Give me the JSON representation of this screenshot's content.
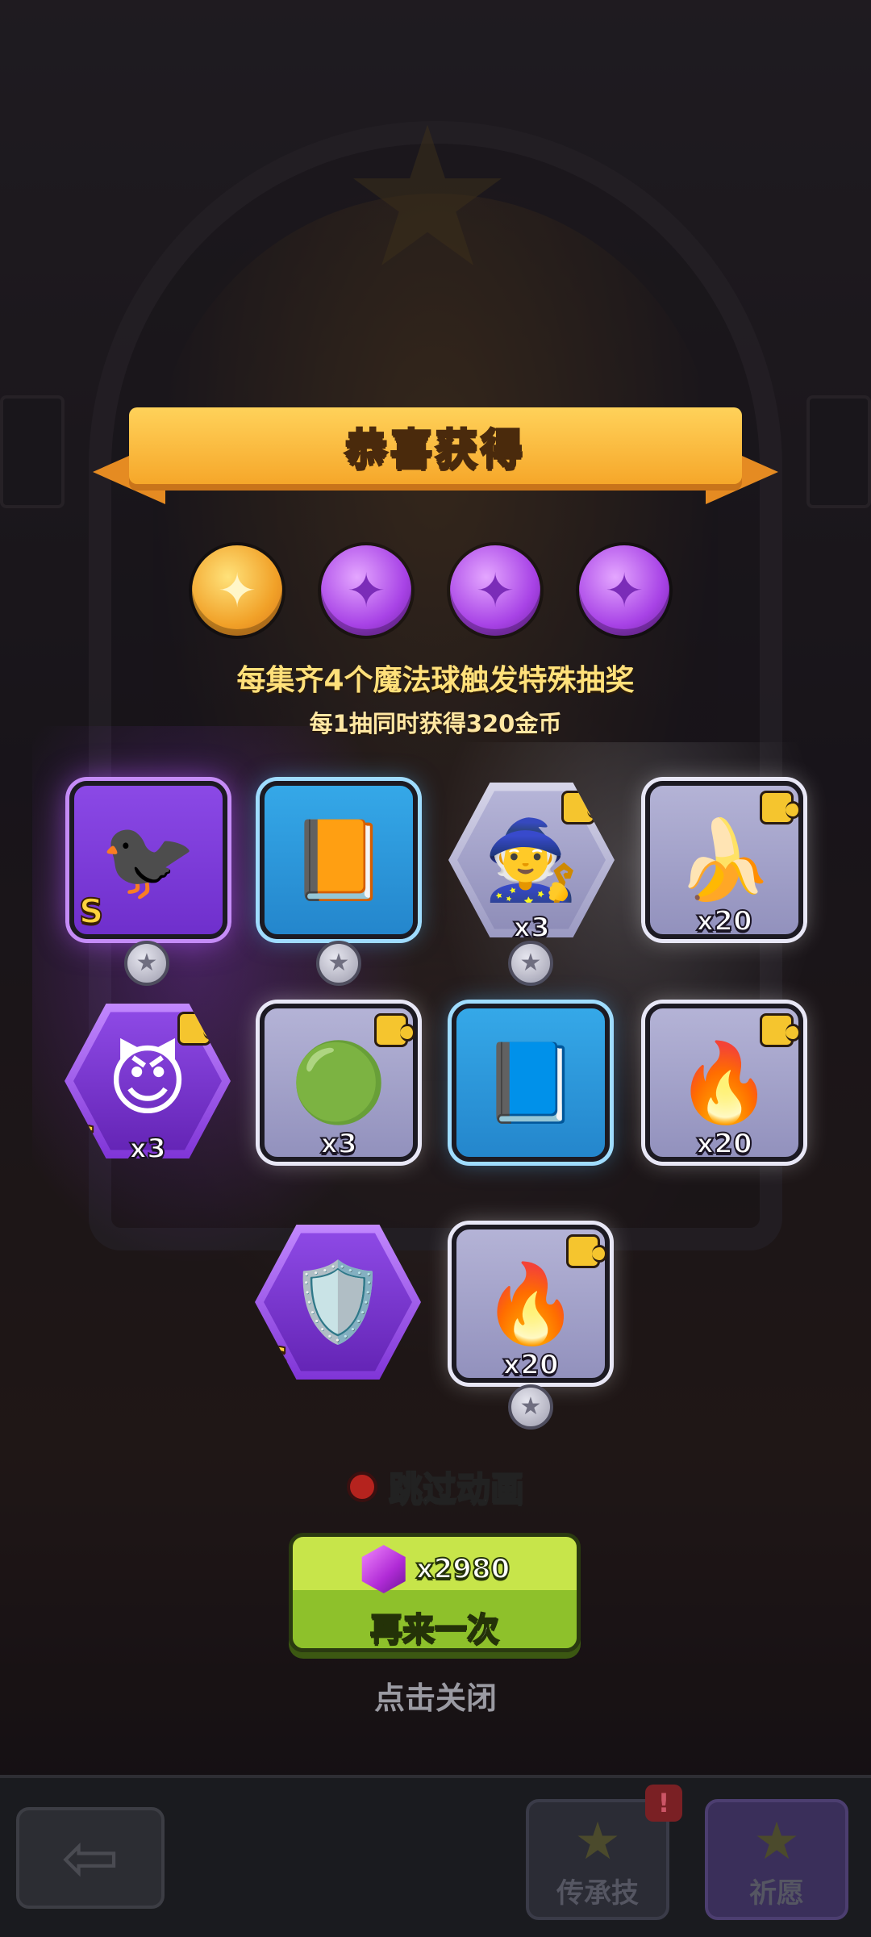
{
  "banner": {
    "title": "恭喜获得"
  },
  "orbs": [
    {
      "icon": "✦",
      "color": "#f1a128",
      "state": "collected-gold"
    },
    {
      "icon": "✦",
      "color": "#a843e6",
      "state": "purple"
    },
    {
      "icon": "✦",
      "color": "#a843e6",
      "state": "purple"
    },
    {
      "icon": "✦",
      "color": "#a843e6",
      "state": "purple"
    }
  ],
  "info": {
    "line1": "每集齐4个魔法球触发特殊抽奖",
    "line2": "每1抽同时获得320金币"
  },
  "rewards": [
    {
      "name": "raven-hero",
      "frame": "purple",
      "rank": "S",
      "qty": "",
      "art": "🐦‍⬛"
    },
    {
      "name": "fire-spellbook",
      "frame": "blue",
      "rank": "",
      "qty": "",
      "art": "📙"
    },
    {
      "name": "red-hood-mage-shard",
      "frame": "gray-hex",
      "rank": "",
      "qty": "x3",
      "art": "🧙"
    },
    {
      "name": "banana-warrior-shard",
      "frame": "gray",
      "rank": "",
      "qty": "x20",
      "art": "🍌"
    },
    {
      "name": "demon-girl-shard",
      "frame": "purple-hex",
      "rank": "S",
      "qty": "x3",
      "art": "😈"
    },
    {
      "name": "slime-shard",
      "frame": "gray",
      "rank": "",
      "qty": "x3",
      "art": "🟢"
    },
    {
      "name": "skull-spellbook",
      "frame": "blue",
      "rank": "",
      "qty": "",
      "art": "📘"
    },
    {
      "name": "flame-spirit-shard",
      "frame": "gray",
      "rank": "",
      "qty": "x20",
      "art": "🔥"
    },
    {
      "name": "golden-knight-hero",
      "frame": "purple-hex",
      "rank": "S",
      "qty": "",
      "art": "🛡️"
    },
    {
      "name": "flame-spirit-shard-2",
      "frame": "gray",
      "rank": "",
      "qty": "x20",
      "art": "🔥"
    }
  ],
  "skip": {
    "label": "跳过动画",
    "checked": true
  },
  "again_button": {
    "cost": "x2980",
    "label": "再来一次",
    "gem_icon": "gem-icon"
  },
  "close_hint": "点击关闭",
  "bottom_bar": {
    "back_icon": "⇦",
    "tab_inherit": "传承技",
    "tab_wish": "祈愿",
    "alert": "!"
  },
  "colors": {
    "accent_gold": "#f6a72a",
    "button_green": "#8ec12b",
    "purple_frame": "#8b49e6",
    "blue_frame": "#2486cc"
  }
}
